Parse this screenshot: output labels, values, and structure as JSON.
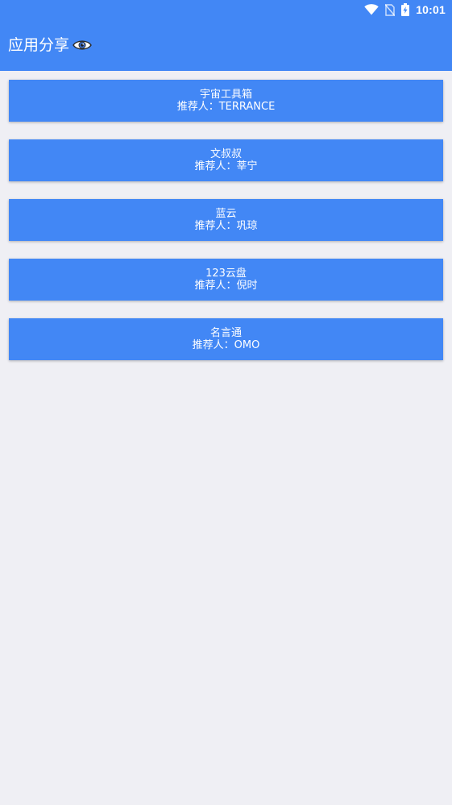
{
  "status_bar": {
    "time": "10:01",
    "icons": [
      "wifi-icon",
      "no-sim-icon",
      "battery-charging-icon"
    ]
  },
  "app_bar": {
    "title": "应用分享",
    "title_icon": "eye-icon"
  },
  "recommender_prefix": "推荐人：",
  "apps": [
    {
      "name": "宇宙工具箱",
      "recommender": "TERRANCE"
    },
    {
      "name": "文叔叔",
      "recommender": "莘宁"
    },
    {
      "name": "蓝云",
      "recommender": "巩琼"
    },
    {
      "name": "123云盘",
      "recommender": "倪时"
    },
    {
      "name": "名言通",
      "recommender": "OMO"
    }
  ],
  "colors": {
    "primary": "#4287f5",
    "background": "#efeff4",
    "text_on_primary": "#ffffff"
  }
}
